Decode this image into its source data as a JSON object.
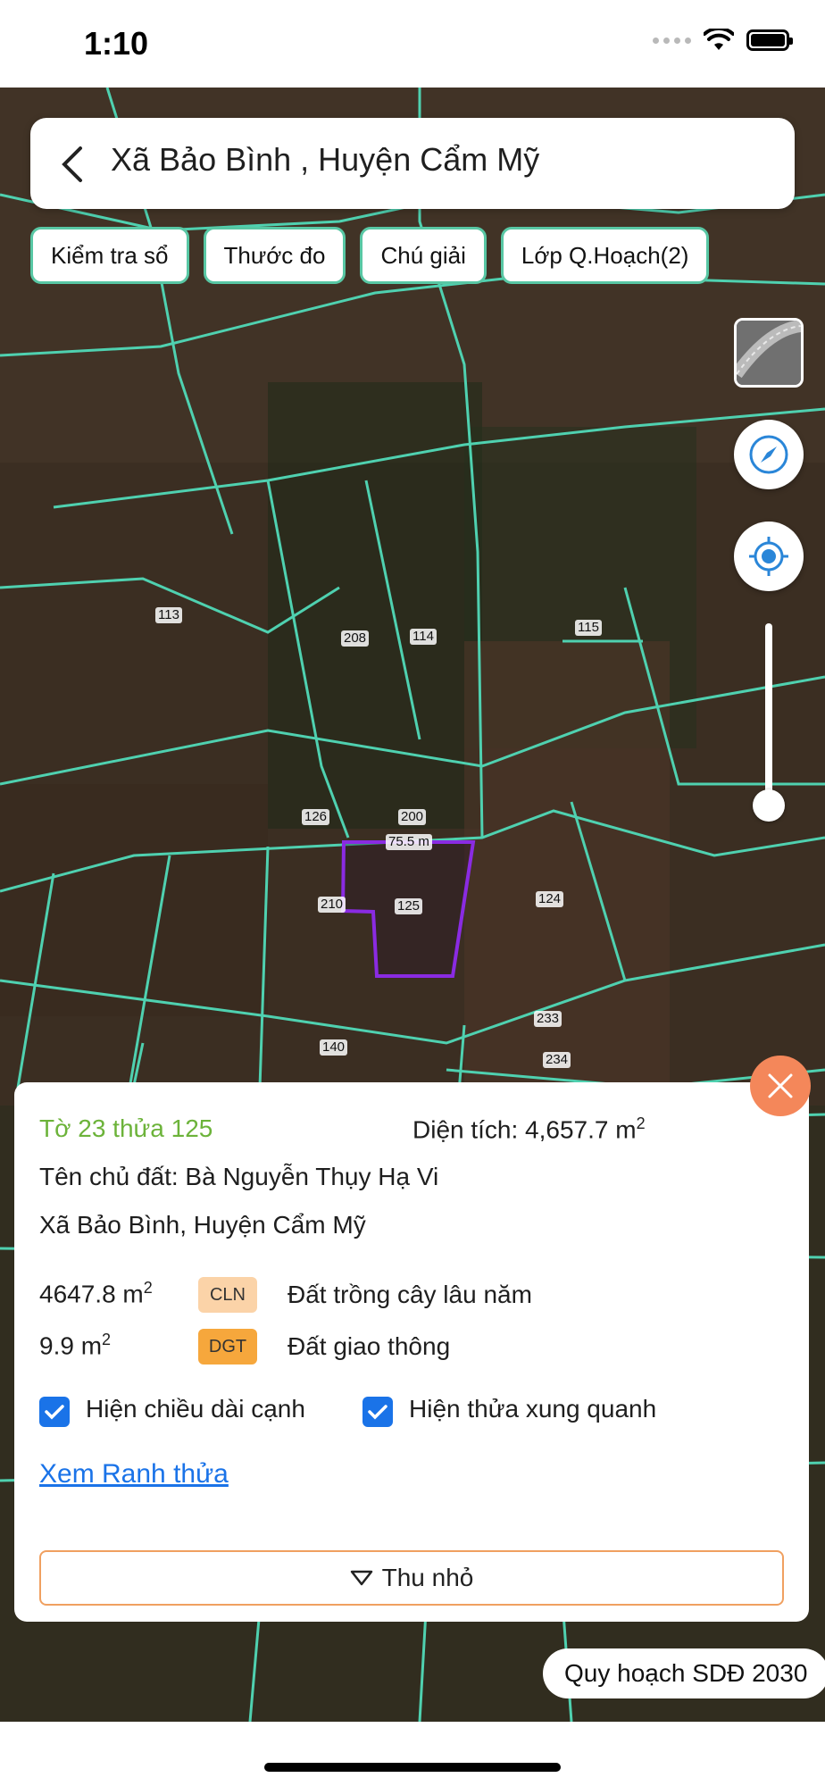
{
  "status_bar": {
    "time": "1:10"
  },
  "search": {
    "title": "Xã Bảo Bình , Huyện Cẩm Mỹ"
  },
  "chips": [
    "Kiểm tra sổ",
    "Thước đo",
    "Chú giải",
    "Lớp Q.Hoạch(2)"
  ],
  "map": {
    "parcel_labels": [
      "113",
      "208",
      "114",
      "115",
      "126",
      "200",
      "75.5 m",
      "210",
      "125",
      "124",
      "233",
      "234",
      "140"
    ],
    "plan_layer": "Quy hoạch SDĐ 2030"
  },
  "panel": {
    "sheet_parcel": "Tờ 23 thửa 125",
    "area_label": "Diện tích: 4,657.7 m",
    "area_sup": "2",
    "owner": "Tên chủ đất: Bà Nguyễn Thụy Hạ Vi",
    "address": "Xã Bảo Bình, Huyện Cẩm Mỹ",
    "land_uses": [
      {
        "area": "4647.8 m",
        "sup": "2",
        "code": "CLN",
        "name": "Đất trồng cây lâu năm",
        "color": "#fbd3a8"
      },
      {
        "area": "9.9 m",
        "sup": "2",
        "code": "DGT",
        "name": "Đất giao thông",
        "color": "#f6a73c"
      }
    ],
    "checkbox_edge": "Hiện chiều dài cạnh",
    "checkbox_neighbors": "Hiện thửa xung quanh",
    "link": "Xem Ranh thửa",
    "collapse": "Thu nhỏ"
  },
  "icons": {
    "back": "chevron-left-icon",
    "compass": "compass-icon",
    "locate": "locate-icon",
    "close": "close-icon",
    "triangle": "triangle-down-icon"
  },
  "colors": {
    "parcel_line": "#4fd1b0",
    "selected_parcel": "#8a2be2",
    "accent": "#1a73e8",
    "close": "#f4875a"
  }
}
